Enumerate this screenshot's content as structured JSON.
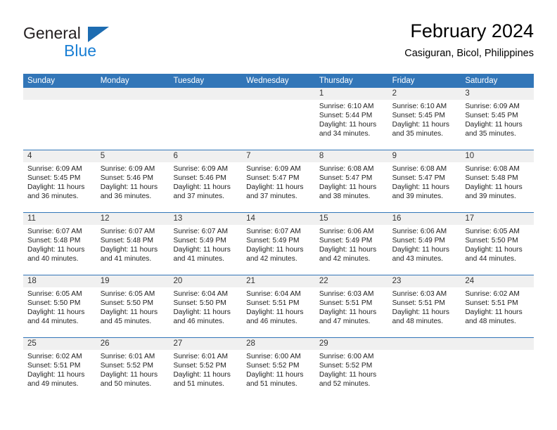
{
  "brand": {
    "name_part1": "General",
    "name_part2": "Blue",
    "triangle_icon": "blue-triangle-logo-icon"
  },
  "header": {
    "title": "February 2024",
    "subtitle": "Casiguran, Bicol, Philippines"
  },
  "colors": {
    "header_blue": "#3276b8",
    "daynum_band": "#f0f0f0",
    "brand_blue": "#1a7fd4",
    "text": "#222222"
  },
  "weekdays": [
    "Sunday",
    "Monday",
    "Tuesday",
    "Wednesday",
    "Thursday",
    "Friday",
    "Saturday"
  ],
  "labels": {
    "sunrise_prefix": "Sunrise: ",
    "sunset_prefix": "Sunset: ",
    "daylight_prefix": "Daylight: "
  },
  "weeks": [
    [
      {
        "day": "",
        "sunrise": "",
        "sunset": "",
        "daylight_line1": "",
        "daylight_line2": ""
      },
      {
        "day": "",
        "sunrise": "",
        "sunset": "",
        "daylight_line1": "",
        "daylight_line2": ""
      },
      {
        "day": "",
        "sunrise": "",
        "sunset": "",
        "daylight_line1": "",
        "daylight_line2": ""
      },
      {
        "day": "",
        "sunrise": "",
        "sunset": "",
        "daylight_line1": "",
        "daylight_line2": ""
      },
      {
        "day": "1",
        "sunrise": "Sunrise: 6:10 AM",
        "sunset": "Sunset: 5:44 PM",
        "daylight_line1": "Daylight: 11 hours",
        "daylight_line2": "and 34 minutes."
      },
      {
        "day": "2",
        "sunrise": "Sunrise: 6:10 AM",
        "sunset": "Sunset: 5:45 PM",
        "daylight_line1": "Daylight: 11 hours",
        "daylight_line2": "and 35 minutes."
      },
      {
        "day": "3",
        "sunrise": "Sunrise: 6:09 AM",
        "sunset": "Sunset: 5:45 PM",
        "daylight_line1": "Daylight: 11 hours",
        "daylight_line2": "and 35 minutes."
      }
    ],
    [
      {
        "day": "4",
        "sunrise": "Sunrise: 6:09 AM",
        "sunset": "Sunset: 5:45 PM",
        "daylight_line1": "Daylight: 11 hours",
        "daylight_line2": "and 36 minutes."
      },
      {
        "day": "5",
        "sunrise": "Sunrise: 6:09 AM",
        "sunset": "Sunset: 5:46 PM",
        "daylight_line1": "Daylight: 11 hours",
        "daylight_line2": "and 36 minutes."
      },
      {
        "day": "6",
        "sunrise": "Sunrise: 6:09 AM",
        "sunset": "Sunset: 5:46 PM",
        "daylight_line1": "Daylight: 11 hours",
        "daylight_line2": "and 37 minutes."
      },
      {
        "day": "7",
        "sunrise": "Sunrise: 6:09 AM",
        "sunset": "Sunset: 5:47 PM",
        "daylight_line1": "Daylight: 11 hours",
        "daylight_line2": "and 37 minutes."
      },
      {
        "day": "8",
        "sunrise": "Sunrise: 6:08 AM",
        "sunset": "Sunset: 5:47 PM",
        "daylight_line1": "Daylight: 11 hours",
        "daylight_line2": "and 38 minutes."
      },
      {
        "day": "9",
        "sunrise": "Sunrise: 6:08 AM",
        "sunset": "Sunset: 5:47 PM",
        "daylight_line1": "Daylight: 11 hours",
        "daylight_line2": "and 39 minutes."
      },
      {
        "day": "10",
        "sunrise": "Sunrise: 6:08 AM",
        "sunset": "Sunset: 5:48 PM",
        "daylight_line1": "Daylight: 11 hours",
        "daylight_line2": "and 39 minutes."
      }
    ],
    [
      {
        "day": "11",
        "sunrise": "Sunrise: 6:07 AM",
        "sunset": "Sunset: 5:48 PM",
        "daylight_line1": "Daylight: 11 hours",
        "daylight_line2": "and 40 minutes."
      },
      {
        "day": "12",
        "sunrise": "Sunrise: 6:07 AM",
        "sunset": "Sunset: 5:48 PM",
        "daylight_line1": "Daylight: 11 hours",
        "daylight_line2": "and 41 minutes."
      },
      {
        "day": "13",
        "sunrise": "Sunrise: 6:07 AM",
        "sunset": "Sunset: 5:49 PM",
        "daylight_line1": "Daylight: 11 hours",
        "daylight_line2": "and 41 minutes."
      },
      {
        "day": "14",
        "sunrise": "Sunrise: 6:07 AM",
        "sunset": "Sunset: 5:49 PM",
        "daylight_line1": "Daylight: 11 hours",
        "daylight_line2": "and 42 minutes."
      },
      {
        "day": "15",
        "sunrise": "Sunrise: 6:06 AM",
        "sunset": "Sunset: 5:49 PM",
        "daylight_line1": "Daylight: 11 hours",
        "daylight_line2": "and 42 minutes."
      },
      {
        "day": "16",
        "sunrise": "Sunrise: 6:06 AM",
        "sunset": "Sunset: 5:49 PM",
        "daylight_line1": "Daylight: 11 hours",
        "daylight_line2": "and 43 minutes."
      },
      {
        "day": "17",
        "sunrise": "Sunrise: 6:05 AM",
        "sunset": "Sunset: 5:50 PM",
        "daylight_line1": "Daylight: 11 hours",
        "daylight_line2": "and 44 minutes."
      }
    ],
    [
      {
        "day": "18",
        "sunrise": "Sunrise: 6:05 AM",
        "sunset": "Sunset: 5:50 PM",
        "daylight_line1": "Daylight: 11 hours",
        "daylight_line2": "and 44 minutes."
      },
      {
        "day": "19",
        "sunrise": "Sunrise: 6:05 AM",
        "sunset": "Sunset: 5:50 PM",
        "daylight_line1": "Daylight: 11 hours",
        "daylight_line2": "and 45 minutes."
      },
      {
        "day": "20",
        "sunrise": "Sunrise: 6:04 AM",
        "sunset": "Sunset: 5:50 PM",
        "daylight_line1": "Daylight: 11 hours",
        "daylight_line2": "and 46 minutes."
      },
      {
        "day": "21",
        "sunrise": "Sunrise: 6:04 AM",
        "sunset": "Sunset: 5:51 PM",
        "daylight_line1": "Daylight: 11 hours",
        "daylight_line2": "and 46 minutes."
      },
      {
        "day": "22",
        "sunrise": "Sunrise: 6:03 AM",
        "sunset": "Sunset: 5:51 PM",
        "daylight_line1": "Daylight: 11 hours",
        "daylight_line2": "and 47 minutes."
      },
      {
        "day": "23",
        "sunrise": "Sunrise: 6:03 AM",
        "sunset": "Sunset: 5:51 PM",
        "daylight_line1": "Daylight: 11 hours",
        "daylight_line2": "and 48 minutes."
      },
      {
        "day": "24",
        "sunrise": "Sunrise: 6:02 AM",
        "sunset": "Sunset: 5:51 PM",
        "daylight_line1": "Daylight: 11 hours",
        "daylight_line2": "and 48 minutes."
      }
    ],
    [
      {
        "day": "25",
        "sunrise": "Sunrise: 6:02 AM",
        "sunset": "Sunset: 5:51 PM",
        "daylight_line1": "Daylight: 11 hours",
        "daylight_line2": "and 49 minutes."
      },
      {
        "day": "26",
        "sunrise": "Sunrise: 6:01 AM",
        "sunset": "Sunset: 5:52 PM",
        "daylight_line1": "Daylight: 11 hours",
        "daylight_line2": "and 50 minutes."
      },
      {
        "day": "27",
        "sunrise": "Sunrise: 6:01 AM",
        "sunset": "Sunset: 5:52 PM",
        "daylight_line1": "Daylight: 11 hours",
        "daylight_line2": "and 51 minutes."
      },
      {
        "day": "28",
        "sunrise": "Sunrise: 6:00 AM",
        "sunset": "Sunset: 5:52 PM",
        "daylight_line1": "Daylight: 11 hours",
        "daylight_line2": "and 51 minutes."
      },
      {
        "day": "29",
        "sunrise": "Sunrise: 6:00 AM",
        "sunset": "Sunset: 5:52 PM",
        "daylight_line1": "Daylight: 11 hours",
        "daylight_line2": "and 52 minutes."
      },
      {
        "day": "",
        "sunrise": "",
        "sunset": "",
        "daylight_line1": "",
        "daylight_line2": ""
      },
      {
        "day": "",
        "sunrise": "",
        "sunset": "",
        "daylight_line1": "",
        "daylight_line2": ""
      }
    ]
  ]
}
